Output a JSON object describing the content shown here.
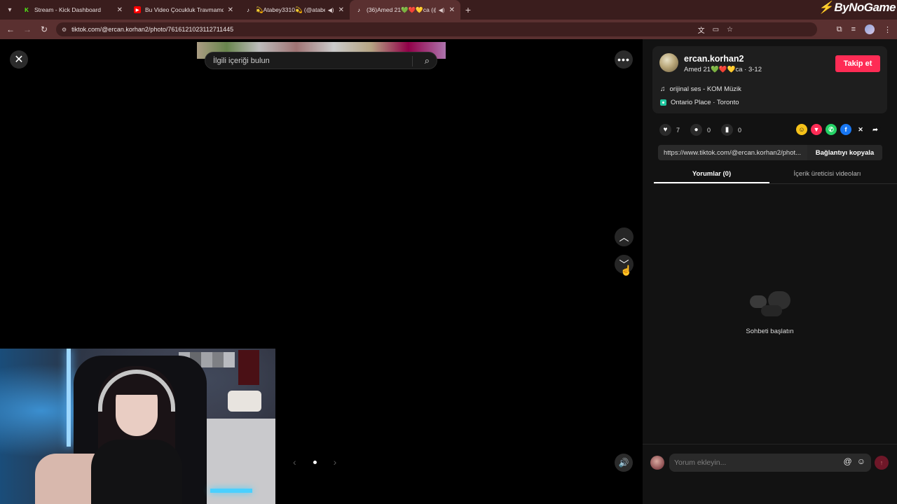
{
  "browser": {
    "tabs": [
      {
        "title": "Stream - Kick Dashboard",
        "favicon": "kick-icon",
        "color": "#53fc18",
        "active": false
      },
      {
        "title": "Bu Video Çocukluk Travmamdı",
        "favicon": "youtube-icon",
        "color": "#ff0000",
        "active": false,
        "audio": false
      },
      {
        "title": "💫Atabey3310💫 (@atabe",
        "favicon": "tiktok-icon",
        "color": "#111111",
        "active": false,
        "audio": true
      },
      {
        "title": "(36)Amed 21💚❤️💛ca (@",
        "favicon": "tiktok-icon",
        "color": "#111111",
        "active": true,
        "audio": true
      }
    ],
    "brand": "ByNoGame",
    "url": "tiktok.com/@ercan.korhan2/photo/7616121023112711445"
  },
  "viewer": {
    "search_placeholder": "İlgili içeriği bulun",
    "close_symbol": "✕",
    "more_symbol": "•••",
    "page_indicator": {
      "current": 1,
      "total": 1
    }
  },
  "panel": {
    "username": "ercan.korhan2",
    "meta": "Amed 21💚❤️💛ca · 3-12",
    "follow_label": "Takip et",
    "music": "orijinal ses - KOM Müzik",
    "location": "Ontario Place · Toronto",
    "stats": {
      "likes": "7",
      "comments": "0",
      "saves": "0"
    },
    "share_targets": [
      {
        "name": "embed-icon",
        "color": "#f6c219",
        "glyph": "☺"
      },
      {
        "name": "send-to-friend-icon",
        "color": "#fe2c55",
        "glyph": "▼"
      },
      {
        "name": "whatsapp-icon",
        "color": "#25d366",
        "glyph": "✆"
      },
      {
        "name": "facebook-icon",
        "color": "#1877f2",
        "glyph": "f"
      },
      {
        "name": "x-icon",
        "color": "#121212",
        "glyph": "✕"
      },
      {
        "name": "share-more-icon",
        "color": "#121212",
        "glyph": "➦"
      }
    ],
    "link_text": "https://www.tiktok.com/@ercan.korhan2/phot...",
    "copy_label": "Bağlantıyı kopyala",
    "tabs": [
      "Yorumlar (0)",
      "İçerik üreticisi videoları"
    ],
    "empty_text": "Sohbeti başlatın",
    "comment_placeholder": "Yorum ekleyin..."
  },
  "colors": {
    "accent": "#fe2c55",
    "chrome_tab_bg": "#3a1d1d",
    "chrome_toolbar": "#5a3030"
  }
}
